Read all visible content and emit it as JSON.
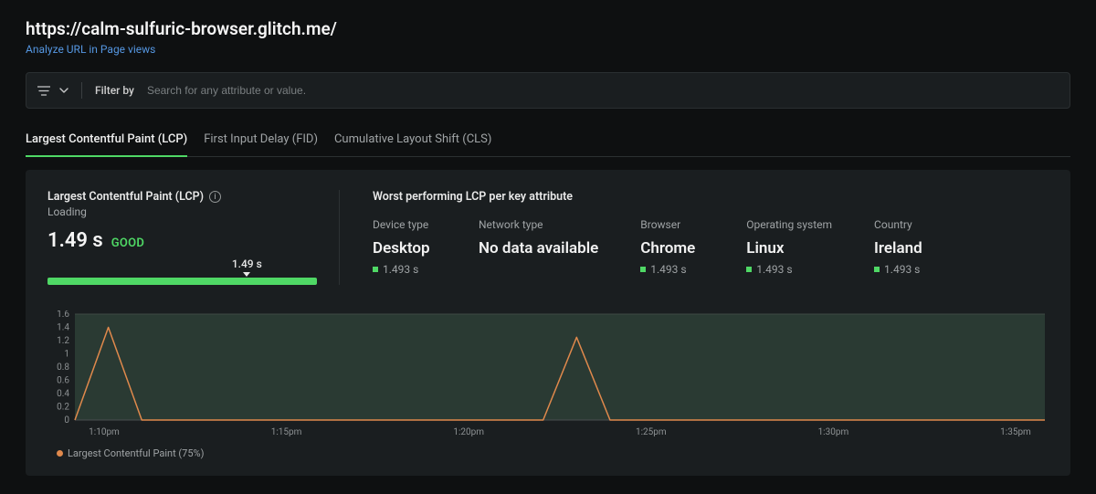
{
  "header": {
    "title": "https://calm-sulfuric-browser.glitch.me/",
    "sublink": "Analyze URL in Page views"
  },
  "filter": {
    "label": "Filter by",
    "placeholder": "Search for any attribute or value."
  },
  "tabs": [
    {
      "label": "Largest Contentful Paint (LCP)",
      "active": true
    },
    {
      "label": "First Input Delay (FID)",
      "active": false
    },
    {
      "label": "Cumulative Layout Shift (CLS)",
      "active": false
    }
  ],
  "metric": {
    "title": "Largest Contentful Paint (LCP)",
    "subtitle": "Loading",
    "value": "1.49 s",
    "grade": "GOOD",
    "slider_label": "1.49 s",
    "slider_position_pct": 74
  },
  "worst": {
    "title": "Worst performing LCP per key attribute",
    "attributes": [
      {
        "label": "Device type",
        "value": "Desktop",
        "sub": "1.493 s",
        "has_dot": true
      },
      {
        "label": "Network type",
        "value": "No data available",
        "sub": "",
        "has_dot": false
      },
      {
        "label": "Browser",
        "value": "Chrome",
        "sub": "1.493 s",
        "has_dot": true
      },
      {
        "label": "Operating system",
        "value": "Linux",
        "sub": "1.493 s",
        "has_dot": true
      },
      {
        "label": "Country",
        "value": "Ireland",
        "sub": "1.493 s",
        "has_dot": true
      }
    ]
  },
  "chart_data": {
    "type": "line",
    "title": "",
    "xlabel": "",
    "ylabel": "",
    "ylim": [
      0,
      1.6
    ],
    "y_ticks": [
      0,
      0.2,
      0.4,
      0.6,
      0.8,
      1,
      1.2,
      1.4,
      1.6
    ],
    "x_ticks": [
      "1:10pm",
      "1:15pm",
      "1:20pm",
      "1:25pm",
      "1:30pm",
      "1:35pm"
    ],
    "series": [
      {
        "name": "Largest Contentful Paint (75%)",
        "color": "#e0894c",
        "values": [
          0,
          1.4,
          0,
          0,
          0,
          0,
          0,
          0,
          0,
          0,
          0,
          0,
          0,
          0,
          0,
          1.25,
          0,
          0,
          0,
          0,
          0,
          0,
          0,
          0,
          0,
          0,
          0,
          0,
          0,
          0
        ]
      }
    ]
  },
  "legend": {
    "label": "Largest Contentful Paint (75%)"
  }
}
